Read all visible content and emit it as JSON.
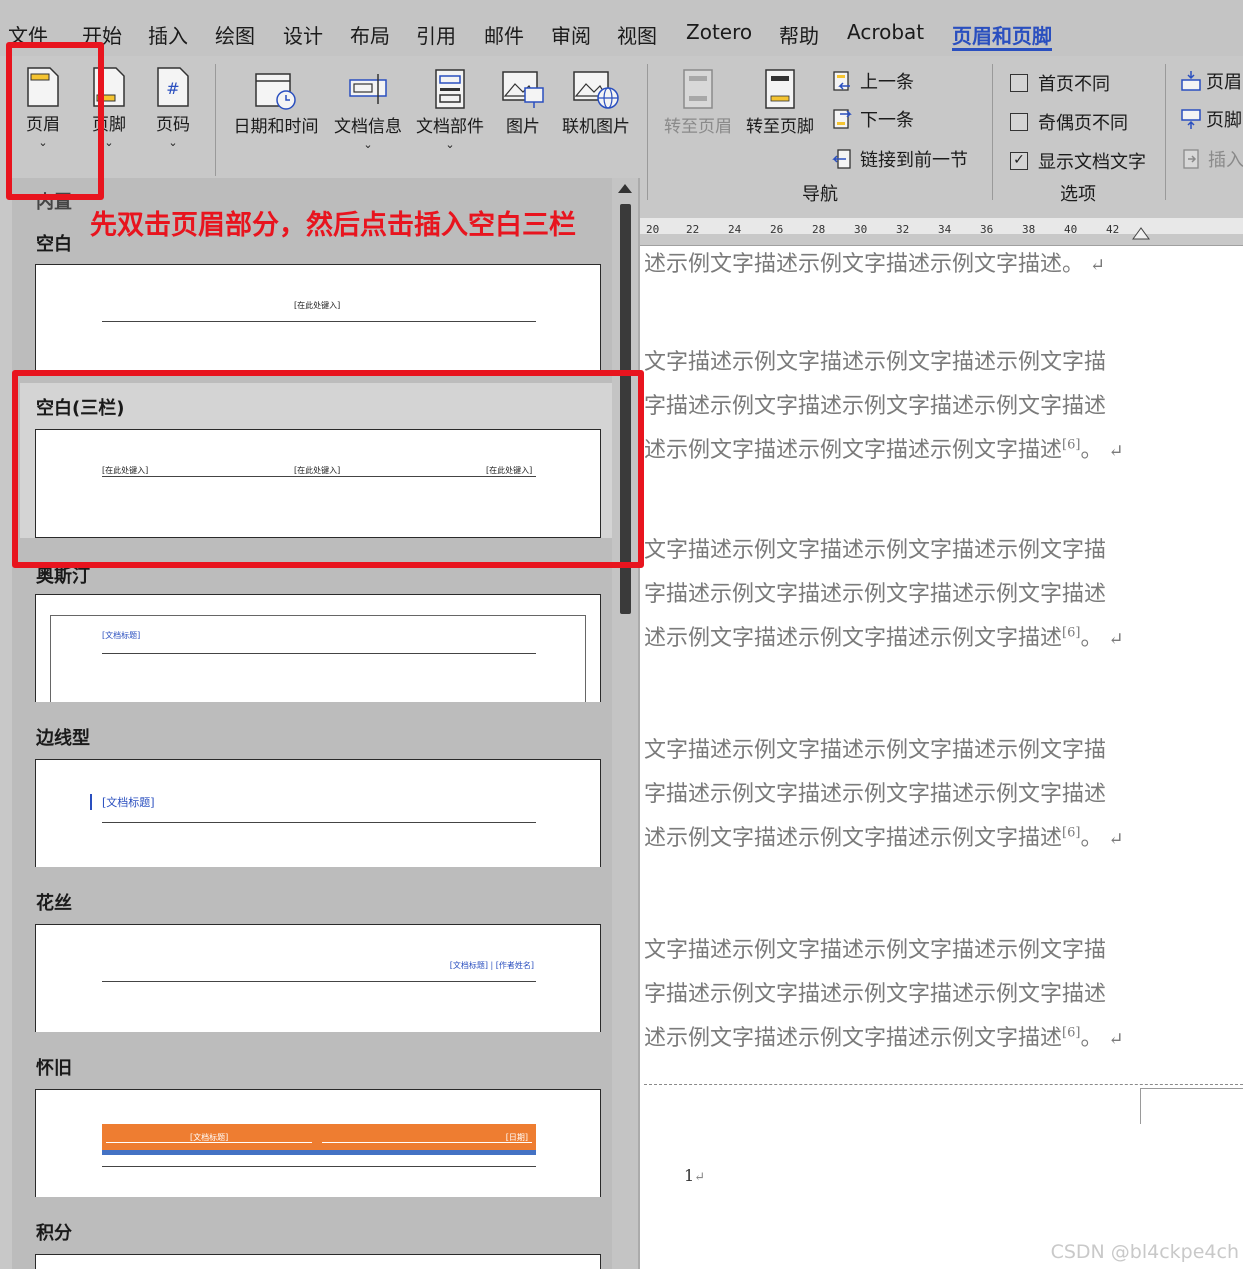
{
  "menu": {
    "items": [
      "文件",
      "开始",
      "插入",
      "绘图",
      "设计",
      "布局",
      "引用",
      "邮件",
      "审阅",
      "视图",
      "Zotero",
      "帮助",
      "Acrobat",
      "页眉和页脚"
    ],
    "active": "页眉和页脚"
  },
  "ribbon": {
    "header_label": "页眉",
    "footer_label": "页脚",
    "page_number_label": "页码",
    "date_time_label": "日期和时间",
    "doc_info_label": "文档信息",
    "doc_parts_label": "文档部件",
    "picture_label": "图片",
    "online_picture_label": "联机图片",
    "goto_header_label": "转至页眉",
    "goto_footer_label": "转至页脚",
    "prev_label": "上一条",
    "next_label": "下一条",
    "link_prev_label": "链接到前一节",
    "nav_group": "导航",
    "diff_first_label": "首页不同",
    "diff_odd_even_label": "奇偶页不同",
    "show_doc_text_label": "显示文档文字",
    "options_group": "选项",
    "header_pos_label": "页眉",
    "footer_pos_label": "页脚",
    "insert_align_label": "插入",
    "show_doc_text_checked": "✓"
  },
  "ruler": {
    "ticks": [
      "20",
      "22",
      "24",
      "26",
      "28",
      "30",
      "32",
      "34",
      "36",
      "38",
      "40",
      "42"
    ]
  },
  "gallery": {
    "builtin_label": "内置",
    "annotation": "先双击页眉部分，然后点击插入空白三栏",
    "sections": [
      {
        "title": "空白",
        "placeholders": [
          "[在此处键入]"
        ]
      },
      {
        "title": "空白(三栏)",
        "placeholders": [
          "[在此处键入]",
          "[在此处键入]",
          "[在此处键入]"
        ]
      },
      {
        "title": "奥斯汀",
        "placeholders": [
          "[文档标题]"
        ]
      },
      {
        "title": "边线型",
        "placeholders": [
          "[文档标题]"
        ]
      },
      {
        "title": "花丝",
        "placeholders": [
          "[文档标题] | [作者姓名]"
        ]
      },
      {
        "title": "怀旧",
        "placeholders": [
          "[文档标题]",
          "[日期]"
        ]
      },
      {
        "title": "积分",
        "placeholders": []
      }
    ]
  },
  "document": {
    "lines": [
      "述示例文字描述示例文字描述示例文字描述。",
      "文字描述示例文字描述示例文字描述示例文字描",
      "字描述示例文字描述示例文字描述示例文字描述",
      "述示例文字描述示例文字描述示例文字描述",
      "文字描述示例文字描述示例文字描述示例文字描",
      "字描述示例文字描述示例文字描述示例文字描述",
      "述示例文字描述示例文字描述示例文字描述",
      "文字描述示例文字描述示例文字描述示例文字描",
      "字描述示例文字描述示例文字描述示例文字描述",
      "述示例文字描述示例文字描述示例文字描述",
      "文字描述示例文字描述示例文字描述示例文字描",
      "字描述示例文字描述示例文字描述示例文字描述",
      "述示例文字描述示例文字描述示例文字描述"
    ],
    "citation": "[6]",
    "page_number": "1",
    "watermark": "CSDN @bl4ckpe4ch"
  },
  "colors": {
    "annotation_red": "#e8141e",
    "active_tab": "#2a4fbf",
    "retro_orange": "#ee7d31",
    "retro_blue": "#4472c4"
  }
}
